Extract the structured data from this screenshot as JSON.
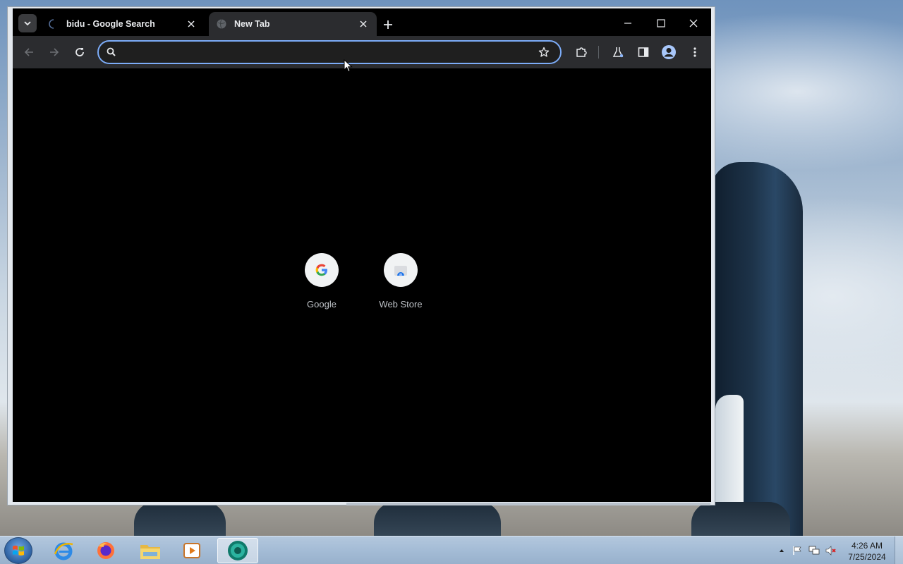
{
  "browser": {
    "tabs": [
      {
        "title": "bidu - Google Search",
        "state": "loading"
      },
      {
        "title": "New Tab",
        "state": "active"
      }
    ],
    "omnibox": {
      "value": "",
      "placeholder": ""
    },
    "accent_color": "#7cacf8"
  },
  "new_tab_page": {
    "shortcuts": [
      {
        "label": "Google",
        "icon": "google-g-icon"
      },
      {
        "label": "Web Store",
        "icon": "web-store-icon"
      }
    ]
  },
  "taskbar": {
    "apps": [
      "internet-explorer-icon",
      "firefox-icon",
      "file-explorer-icon",
      "media-player-icon",
      "chrome-icon"
    ],
    "clock": {
      "time": "4:26 AM",
      "date": "7/25/2024"
    }
  }
}
